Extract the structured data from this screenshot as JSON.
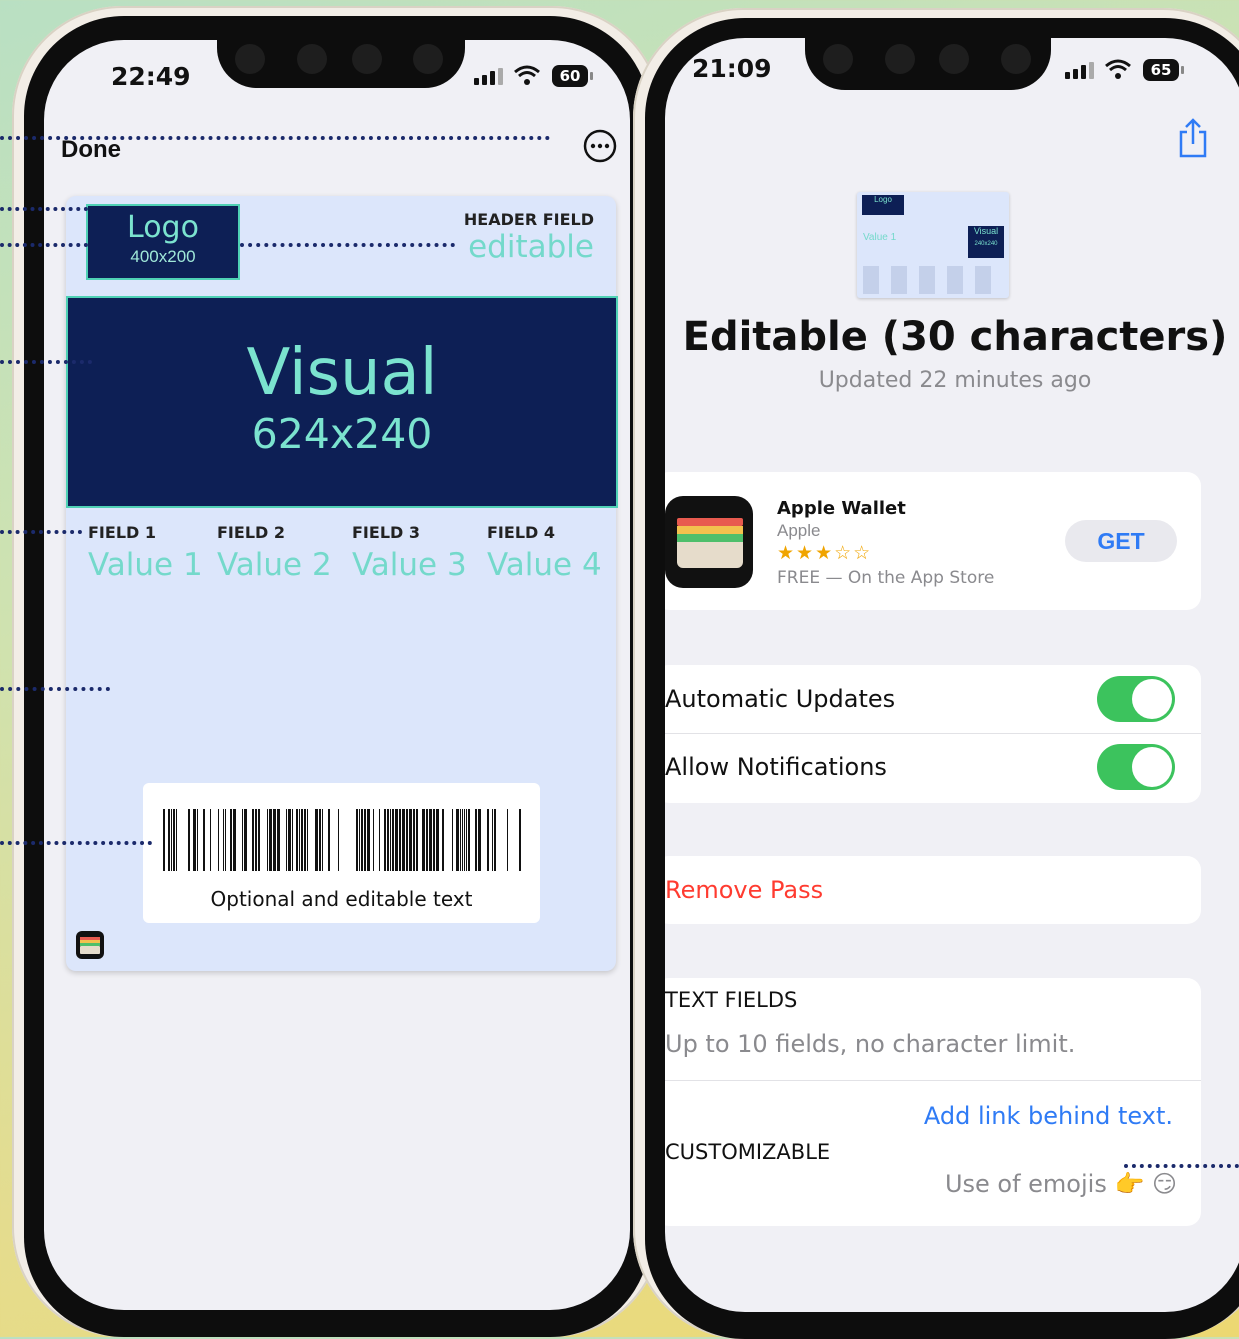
{
  "left_phone": {
    "time": "22:49",
    "battery": "60",
    "done_label": "Done",
    "more_icon": "ellipsis-circle-icon",
    "pass": {
      "logo_title": "Logo",
      "logo_size": "400x200",
      "header_field_label": "HEADER FIELD",
      "header_field_value": "editable",
      "visual_title": "Visual",
      "visual_size": "624x240",
      "fields": [
        {
          "label": "FIELD 1",
          "value": "Value 1"
        },
        {
          "label": "FIELD 2",
          "value": "Value 2"
        },
        {
          "label": "FIELD 3",
          "value": "Value 3"
        },
        {
          "label": "FIELD 4",
          "value": "Value 4"
        }
      ],
      "barcode_text": "Optional and editable text"
    }
  },
  "right_phone": {
    "time": "21:09",
    "battery": "65",
    "share_icon": "share-icon",
    "thumb": {
      "logo": "Logo",
      "value": "Value 1",
      "visual": "Visual",
      "visual_size": "240x240"
    },
    "title": "Editable (30 characters)",
    "updated": "Updated 22 minutes ago",
    "app": {
      "name": "Apple Wallet",
      "developer": "Apple",
      "stars": "★★★☆☆",
      "rating": 3,
      "price_line": "FREE — On the App Store",
      "get_label": "GET"
    },
    "settings": [
      {
        "label": "Automatic Updates",
        "on": true
      },
      {
        "label": "Allow Notifications",
        "on": true
      }
    ],
    "remove_label": "Remove Pass",
    "text_fields_title": "TEXT FIELDS",
    "text_fields_desc": "Up to 10 fields, no character limit.",
    "customizable_label": "CUSTOMIZABLE",
    "link_text": "Add link behind text.",
    "emoji_text": "Use of emojis 👉 😏"
  },
  "colors": {
    "navy": "#0d1f55",
    "teal": "#4fd1b5",
    "accent_blue": "#2f7bf5",
    "red": "#ff3b30",
    "green": "#3cc35d"
  }
}
